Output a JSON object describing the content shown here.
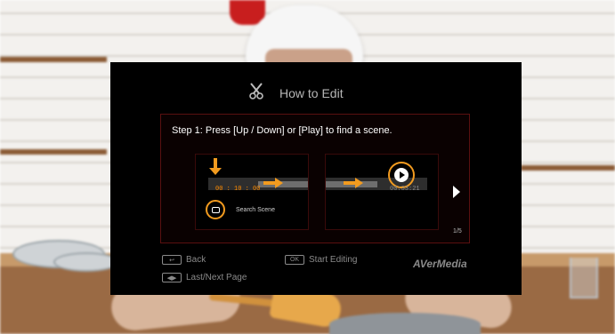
{
  "dialog": {
    "title": "How to Edit",
    "step_text": "Step 1: Press [Up / Down] or [Play]  to find a scene.",
    "illustration": {
      "card1_time": "00 : 10 : 00",
      "card1_search_label": "Search Scene",
      "card2_time": "00:33:21"
    },
    "page_indicator": "1/5",
    "footer": {
      "back_label": "Back",
      "start_editing_key": "OK",
      "start_editing_label": "Start Editing",
      "last_next_label": "Last/Next Page"
    },
    "brand": "AVerMedia"
  },
  "colors": {
    "accent": "#f29b1f",
    "panel_border": "#5a1010",
    "dialog_bg": "#000000"
  },
  "icons": {
    "title_icon": "scissors-icon",
    "next_icon": "chevron-right-icon",
    "back_icon": "back-arrow-icon",
    "nav_icon": "left-right-arrows-icon",
    "play_icon": "play-icon",
    "search_icon": "up-down-button-icon"
  }
}
